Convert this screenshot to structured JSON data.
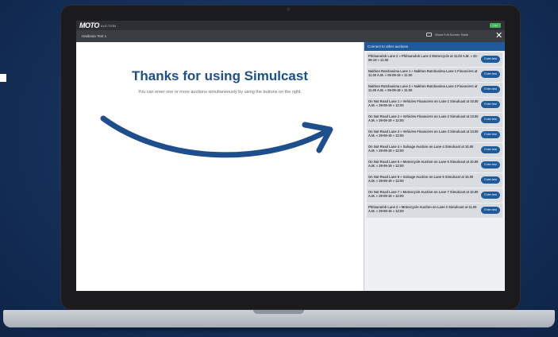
{
  "app": {
    "logo_main": "MOTO",
    "logo_sub": "AUCTION",
    "status_badge": "Live"
  },
  "toolbar": {
    "auction_tab": "Hasbrain Test 1",
    "fullscreen_label": "Show Full Screen Table",
    "close_symbol": "✕"
  },
  "welcome": {
    "title": "Thanks for using Simulcast",
    "subtitle": "You can enter one or more auctions simultaneously by using the buttons on the right."
  },
  "panel": {
    "header": "Connect to other auctions",
    "enter_label": "Enter test",
    "items": [
      "Phitsanulok Lane 2 » Phitsanulok Lane 2 Motorcycle at 11.00 A.M. » 22-08-19 » 11:00",
      "Nakhon Ratchasima Lane 1 » Nakhon Ratchasima Lane 1 Financiers at 11.00 A.M. » 05-09-19 » 11:00",
      "Nakhon Ratchasima Lane 2 » Nakhon Ratchasima Lane 2 Financiers at 11.00 A.M. » 05-09-19 » 11:00",
      "On Nut Road Lane 1 » Vehicles Financiers on Lane 1 Simulcast at 10.00 A.M. » 29-09-19 » 12:00",
      "On Nut Road Lane 2 » Vehicles Financiers on Lane 2 Simulcast at 10.00 A.M. » 29-09-19 » 12:00",
      "On Nut Road Lane 3 » Vehicles Financiers on Lane 3 Simulcast at 10.00 A.M. » 29-09-19 » 12:00",
      "On Nut Road Lane 4 » Salvage Auction on Lane 4 Simulcast at 10.00 A.M. » 29-09-19 » 12:00",
      "On Nut Road Lane 5 » Motorcycle Auction on Lane 5 Simulcast at 10.00 A.M. » 29-09-19 » 12:00",
      "On Nut Road Lane 6 » Salvage Auction on Lane 6 Simulcast at 10.00 A.M. » 29-09-19 » 12:00",
      "On Nut Road Lane 7 » Motorcycle Auction on Lane 7 Simulcast at 10.00 A.M. » 29-09-19 » 12:00",
      "Phitsanulok Lane 2 » Motorcycle Auction on Lane 2 Simulcast at 11.00 A.M. » 29-09-19 » 12:00"
    ]
  },
  "colors": {
    "brand_blue": "#1e4f8c",
    "button_blue": "#1f5a9a",
    "live_green": "#46b25a"
  }
}
